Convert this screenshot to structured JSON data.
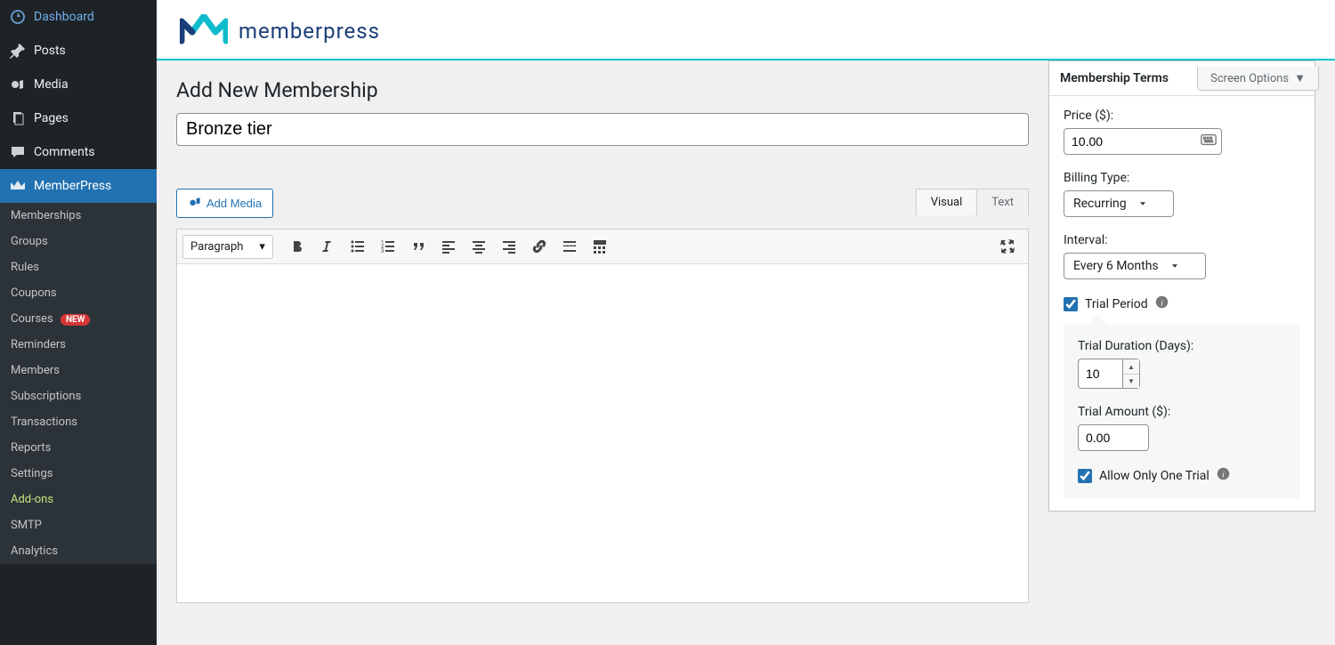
{
  "sidebar": {
    "dashboard": "Dashboard",
    "posts": "Posts",
    "media": "Media",
    "pages": "Pages",
    "comments": "Comments",
    "memberpress": "MemberPress",
    "submenu": {
      "memberships": "Memberships",
      "groups": "Groups",
      "rules": "Rules",
      "coupons": "Coupons",
      "courses": "Courses",
      "courses_badge": "NEW",
      "reminders": "Reminders",
      "members": "Members",
      "subscriptions": "Subscriptions",
      "transactions": "Transactions",
      "reports": "Reports",
      "settings": "Settings",
      "addons": "Add-ons",
      "smtp": "SMTP",
      "analytics": "Analytics"
    }
  },
  "brand": {
    "name": "memberpress"
  },
  "screen_options": "Screen Options",
  "page_title": "Add New Membership",
  "title_value": "Bronze tier",
  "editor": {
    "add_media": "Add Media",
    "tab_visual": "Visual",
    "tab_text": "Text",
    "format_select": "Paragraph"
  },
  "terms": {
    "title": "Membership Terms",
    "price_label": "Price ($):",
    "price_value": "10.00",
    "billing_label": "Billing Type:",
    "billing_value": "Recurring",
    "interval_label": "Interval:",
    "interval_value": "Every 6 Months",
    "trial_period": "Trial Period",
    "trial_duration_label": "Trial Duration (Days):",
    "trial_duration_value": "10",
    "trial_amount_label": "Trial Amount ($):",
    "trial_amount_value": "0.00",
    "allow_one_trial": "Allow Only One Trial"
  }
}
